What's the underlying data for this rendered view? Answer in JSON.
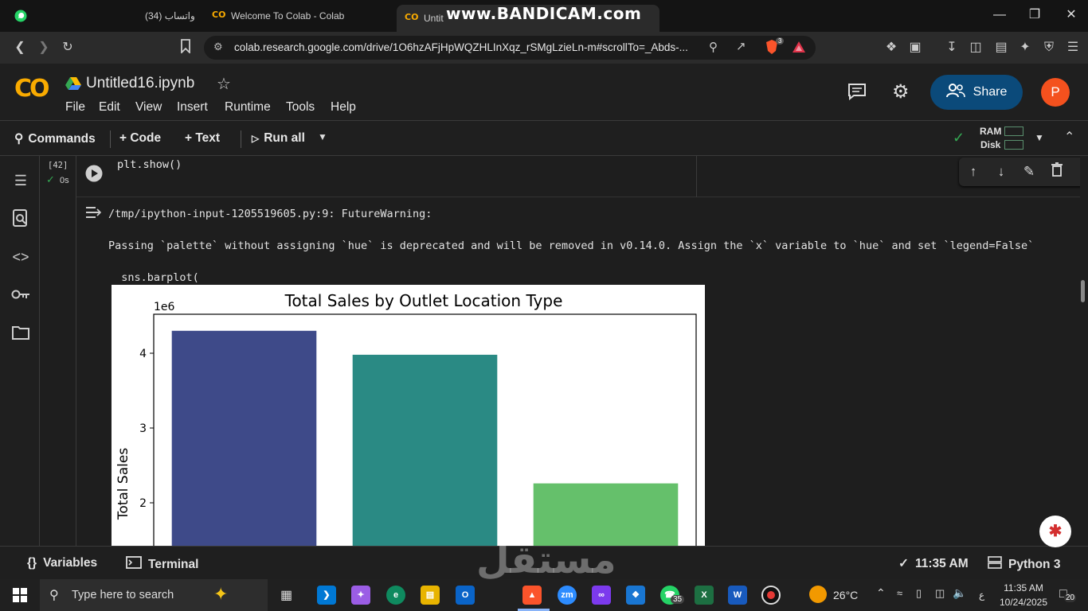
{
  "browser": {
    "tabs": [
      {
        "label": "(34) واتساب"
      },
      {
        "label": "Welcome To Colab - Colab"
      },
      {
        "label": "Untit"
      }
    ],
    "recorder_watermark": "www.BANDICAM.com",
    "url": "colab.research.google.com/drive/1O6hzAFjHpWQZHLInXqz_rSMgLzieLn-m#scrollTo=_Abds-...",
    "brave_badge": "3"
  },
  "colab": {
    "notebook_title": "Untitled16.ipynb",
    "menu": [
      "File",
      "Edit",
      "View",
      "Insert",
      "Runtime",
      "Tools",
      "Help"
    ],
    "share_label": "Share",
    "avatar_letter": "P",
    "toolbar": {
      "commands": "Commands",
      "code": "+ Code",
      "text": "+ Text",
      "run_all": "Run all",
      "ram": "RAM",
      "disk": "Disk"
    }
  },
  "cell": {
    "exec_count": "[42]",
    "exec_time": "0s",
    "code": "plt.show()",
    "output": {
      "line1": "/tmp/ipython-input-1205519605.py:9: FutureWarning:",
      "line2": "Passing `palette` without assigning `hue` is deprecated and will be removed in v0.14.0. Assign the `x` variable to `hue` and set `legend=False`",
      "line3": "  sns.barplot("
    }
  },
  "chart_data": {
    "type": "bar",
    "title": "Total Sales by Outlet Location Type",
    "ylabel": "Total Sales",
    "xlabel": "",
    "y_offset_label": "1e6",
    "y_ticks": [
      "2",
      "3",
      "4"
    ],
    "values": [
      4.3,
      3.98,
      2.26
    ],
    "colors": [
      "#3e4a89",
      "#2a8a84",
      "#65c06b"
    ],
    "ylim_visible": [
      1.4,
      4.5
    ]
  },
  "statusbar": {
    "variables": "Variables",
    "terminal": "Terminal",
    "time": "11:35 AM",
    "runtime": "Python 3"
  },
  "taskbar": {
    "search_placeholder": "Type here to search",
    "weather": "26°C",
    "clock_time": "11:35 AM",
    "clock_date": "10/24/2025",
    "whatsapp_badge": "35",
    "notifications": "20",
    "lang": "ع"
  },
  "watermark": "مستقل"
}
